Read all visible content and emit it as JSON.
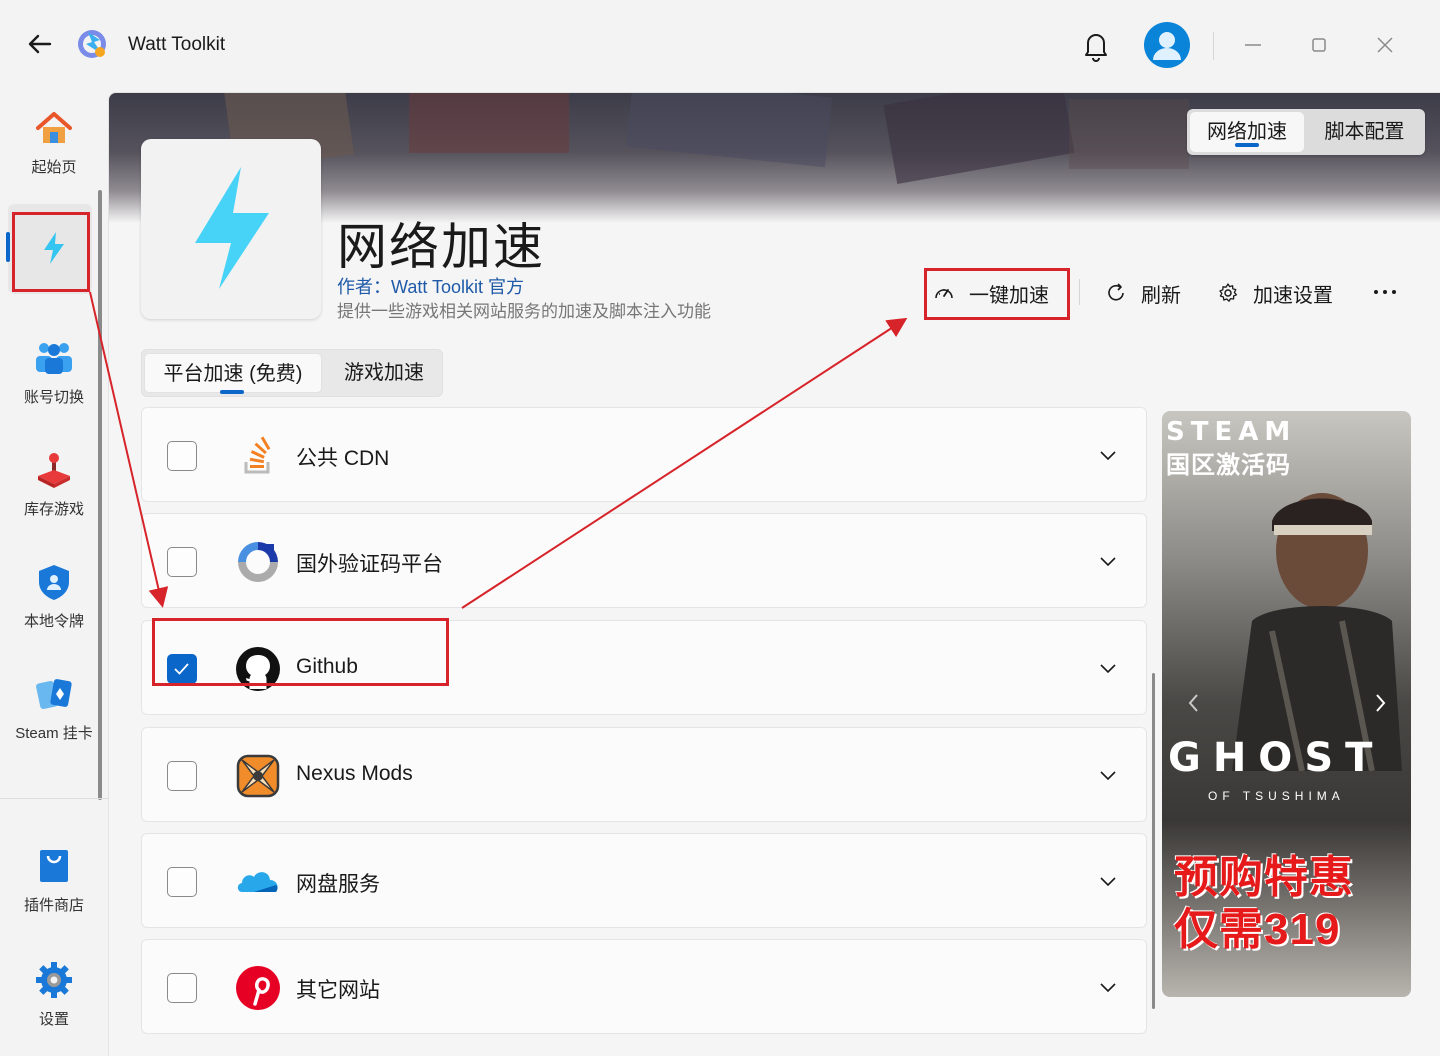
{
  "window": {
    "title": "Watt Toolkit"
  },
  "sidebar": {
    "items": [
      {
        "label": "起始页",
        "icon": "home-icon"
      },
      {
        "label": "",
        "icon": "lightning-icon"
      },
      {
        "label": "账号切换",
        "icon": "users-icon"
      },
      {
        "label": "库存游戏",
        "icon": "joystick-icon"
      },
      {
        "label": "本地令牌",
        "icon": "shield-icon"
      },
      {
        "label": "Steam 挂卡",
        "icon": "cards-icon"
      }
    ],
    "bottom": [
      {
        "label": "插件商店",
        "icon": "shop-bag-icon"
      },
      {
        "label": "设置",
        "icon": "gear-icon"
      }
    ]
  },
  "plugin": {
    "title": "网络加速",
    "author": "作者：Watt Toolkit 官方",
    "description": "提供一些游戏相关网站服务的加速及脚本注入功能"
  },
  "top_tabs": [
    {
      "label": "网络加速",
      "active": true
    },
    {
      "label": "脚本配置",
      "active": false
    }
  ],
  "actions": {
    "one_click": "一键加速",
    "refresh": "刷新",
    "settings": "加速设置"
  },
  "sub_tabs": [
    {
      "label": "平台加速 (免费)",
      "active": true
    },
    {
      "label": "游戏加速",
      "active": false
    }
  ],
  "services": [
    {
      "label": "公共 CDN",
      "checked": false,
      "icon": "stack-overflow-icon"
    },
    {
      "label": "国外验证码平台",
      "checked": false,
      "icon": "recaptcha-icon"
    },
    {
      "label": "Github",
      "checked": true,
      "icon": "github-icon"
    },
    {
      "label": "Nexus Mods",
      "checked": false,
      "icon": "nexus-mods-icon"
    },
    {
      "label": "网盘服务",
      "checked": false,
      "icon": "onedrive-cloud-icon"
    },
    {
      "label": "其它网站",
      "checked": false,
      "icon": "pinterest-icon"
    }
  ],
  "ad": {
    "steam": "STEAM",
    "subtitle": "国区激活码",
    "game": "GHOST",
    "game_sub": "OF TSUSHIMA",
    "promo_line1": "预购特惠",
    "promo_line2": "仅需319"
  },
  "colors": {
    "accent": "#0a66c8",
    "highlight_red": "#d6242a"
  }
}
